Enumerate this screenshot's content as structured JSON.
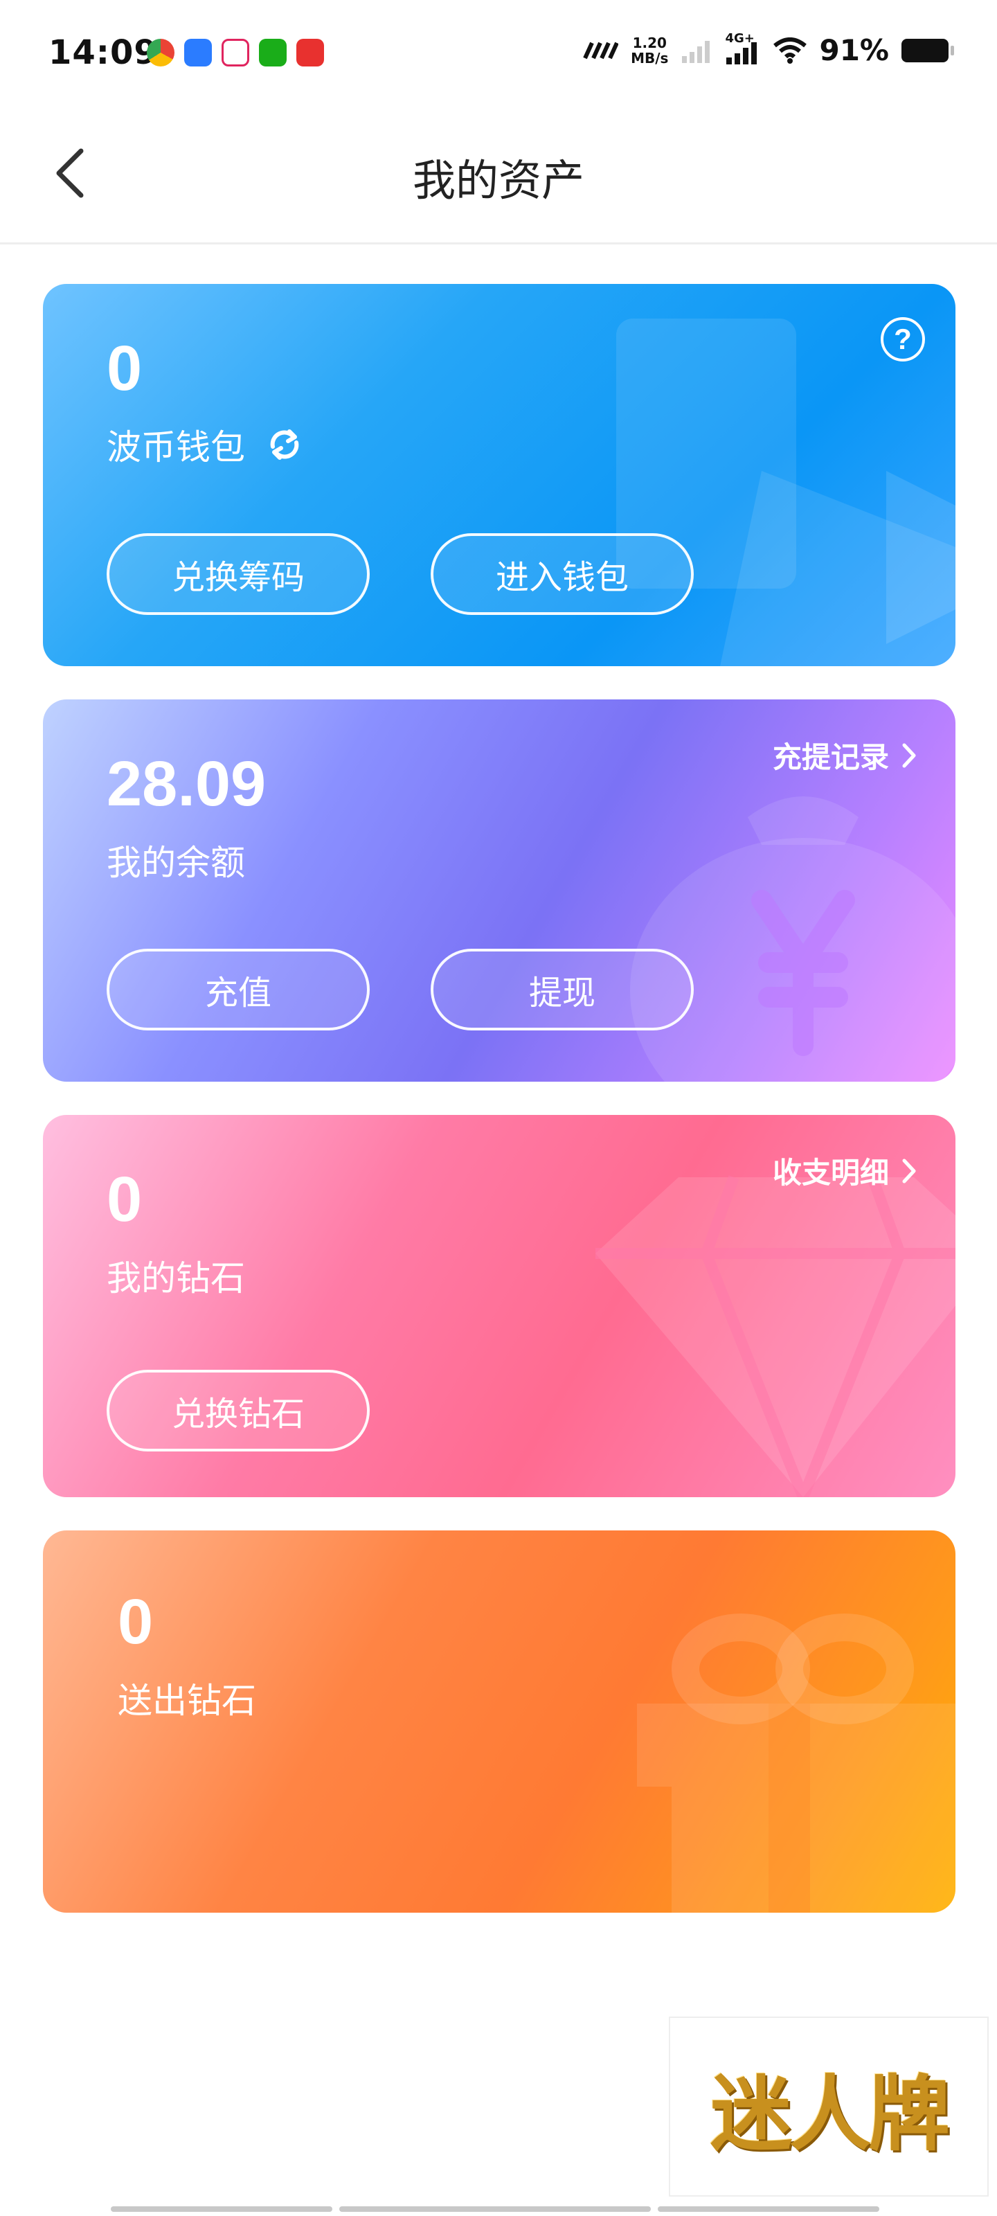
{
  "status_bar": {
    "time": "14:09",
    "speed_value": "1.20",
    "speed_unit": "MB/s",
    "network": "4G+",
    "battery": "91%"
  },
  "header": {
    "title": "我的资产"
  },
  "wallet_card": {
    "value": "0",
    "label": "波币钱包",
    "help": "?",
    "buttons": [
      "兑换筹码",
      "进入钱包"
    ],
    "accent": "#1aa0f7"
  },
  "balance_card": {
    "value": "28.09",
    "label": "我的余额",
    "link": "充提记录",
    "buttons": [
      "充值",
      "提现"
    ],
    "accent": "#7b72f5"
  },
  "diamond_card": {
    "value": "0",
    "label": "我的钻石",
    "link": "收支明细",
    "buttons": [
      "兑换钻石"
    ],
    "accent": "#ff6b91"
  },
  "sent_card": {
    "value": "0",
    "label": "送出钻石",
    "accent": "#ff7a33"
  },
  "watermark": {
    "text": "迷人牌"
  },
  "icons": {
    "back": "chevron-left-icon",
    "refresh": "refresh-icon",
    "help": "help-circle-icon",
    "link": "chevron-right-icon"
  }
}
